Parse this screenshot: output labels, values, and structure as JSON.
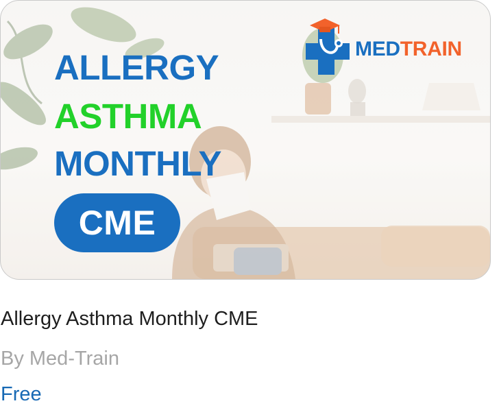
{
  "banner": {
    "line1": "ALLERGY",
    "line2": "ASTHMA",
    "line3": "MONTHLY",
    "pill": "CME",
    "logo_med": "MED",
    "logo_train": "TRAIN"
  },
  "course": {
    "title": "Allergy Asthma Monthly CME",
    "author": "By Med-Train",
    "price": "Free"
  },
  "colors": {
    "brand_blue": "#1a6fc0",
    "accent_green": "#22d12a",
    "logo_orange": "#f2622b",
    "price_blue": "#1769b4",
    "muted_gray": "#a6a6a6"
  },
  "icons": [
    "medical-cross-stethoscope-icon",
    "graduation-cap-icon"
  ]
}
